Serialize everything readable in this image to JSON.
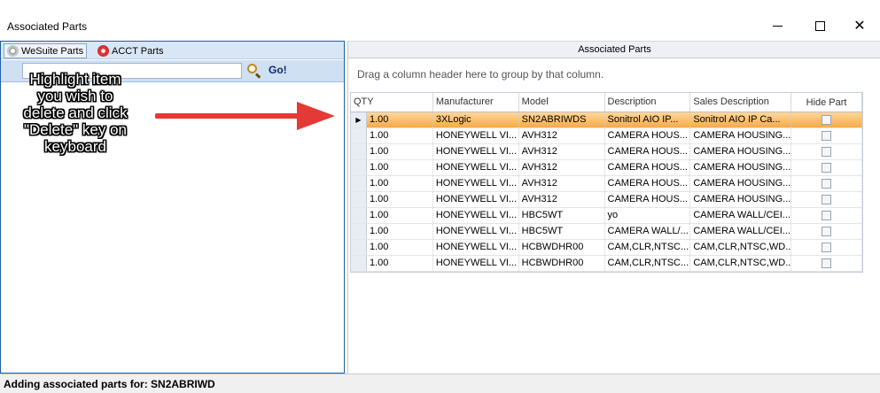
{
  "window": {
    "title": "Associated Parts"
  },
  "left": {
    "tabs": [
      {
        "label": "WeSuite Parts",
        "icon": "gear-icon"
      },
      {
        "label": "ACCT Parts",
        "icon": "gear-red-icon"
      }
    ],
    "search": {
      "value": "",
      "placeholder": ""
    },
    "go_label": "Go!"
  },
  "annotation": {
    "text": "Highlight item\nyou wish to\ndelete and click\n\"Delete\" key on\nkeyboard",
    "arrow_color": "#e53935"
  },
  "right": {
    "header": "Associated Parts",
    "group_hint": "Drag a column header here to group by that column.",
    "columns": [
      "QTY",
      "Manufacturer",
      "Model",
      "Description",
      "Sales Description",
      "Hide Part"
    ],
    "rows": [
      {
        "qty": "1.00",
        "mfr": "3XLogic",
        "model": "SN2ABRIWDS",
        "desc": "Sonitrol AIO IP...",
        "sales": "Sonitrol AIO IP Ca...",
        "selected": true
      },
      {
        "qty": "1.00",
        "mfr": "HONEYWELL VI...",
        "model": "AVH312",
        "desc": "CAMERA HOUS...",
        "sales": "CAMERA HOUSING...",
        "selected": false
      },
      {
        "qty": "1.00",
        "mfr": "HONEYWELL VI...",
        "model": "AVH312",
        "desc": "CAMERA HOUS...",
        "sales": "CAMERA HOUSING...",
        "selected": false
      },
      {
        "qty": "1.00",
        "mfr": "HONEYWELL VI...",
        "model": "AVH312",
        "desc": "CAMERA HOUS...",
        "sales": "CAMERA HOUSING...",
        "selected": false
      },
      {
        "qty": "1.00",
        "mfr": "HONEYWELL VI...",
        "model": "AVH312",
        "desc": "CAMERA HOUS...",
        "sales": "CAMERA HOUSING...",
        "selected": false
      },
      {
        "qty": "1.00",
        "mfr": "HONEYWELL VI...",
        "model": "AVH312",
        "desc": "CAMERA HOUS...",
        "sales": "CAMERA HOUSING...",
        "selected": false
      },
      {
        "qty": "1.00",
        "mfr": "HONEYWELL VI...",
        "model": "HBC5WT",
        "desc": "yo",
        "sales": "CAMERA WALL/CEI...",
        "selected": false
      },
      {
        "qty": "1.00",
        "mfr": "HONEYWELL VI...",
        "model": "HBC5WT",
        "desc": "CAMERA WALL/...",
        "sales": "CAMERA WALL/CEI...",
        "selected": false
      },
      {
        "qty": "1.00",
        "mfr": "HONEYWELL VI...",
        "model": "HCBWDHR00",
        "desc": "CAM,CLR,NTSC...",
        "sales": "CAM,CLR,NTSC,WD...",
        "selected": false
      },
      {
        "qty": "1.00",
        "mfr": "HONEYWELL VI...",
        "model": "HCBWDHR00",
        "desc": "CAM,CLR,NTSC...",
        "sales": "CAM,CLR,NTSC,WD...",
        "selected": false
      }
    ]
  },
  "status": {
    "text": "Adding associated parts for: SN2ABRIWD"
  }
}
